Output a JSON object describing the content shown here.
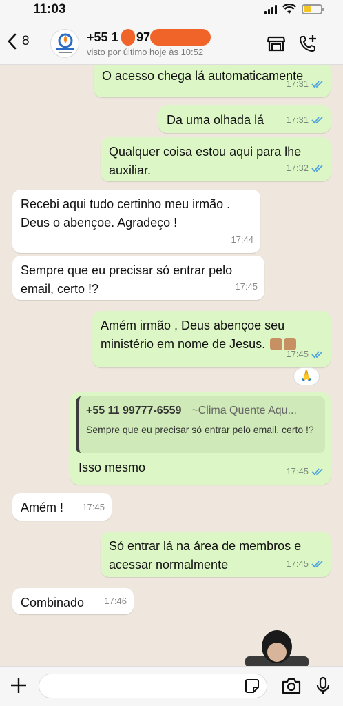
{
  "status_bar": {
    "time": "11:03"
  },
  "header": {
    "back_count": "8",
    "contact_name": "+55 1",
    "contact_name_tail": "97",
    "last_seen": "visto por último hoje às 10:52"
  },
  "messages": [
    {
      "dir": "out",
      "text": "O acesso chega lá automaticamente",
      "time": "17:31"
    },
    {
      "dir": "out",
      "text": "Da uma olhada lá",
      "time": "17:31"
    },
    {
      "dir": "out",
      "text": "Qualquer coisa estou aqui para lhe auxiliar.",
      "time": "17:32"
    },
    {
      "dir": "in",
      "text": "Recebi aqui tudo certinho meu irmão . Deus o abençoe. Agradeço !",
      "time": "17:44"
    },
    {
      "dir": "in",
      "text": "Sempre que eu precisar só entrar pelo email, certo !?",
      "time": "17:45"
    },
    {
      "dir": "out",
      "text": "Amém irmão , Deus abençoe seu ministério em nome de Jesus.",
      "time": "17:45"
    },
    {
      "dir": "out",
      "quote_phone": "+55 11 99777-6559",
      "quote_org": "~Clima Quente Aqu...",
      "quote_text": "Sempre que eu precisar só entrar pelo email, certo !?",
      "text": "Isso mesmo",
      "time": "17:45"
    },
    {
      "dir": "in",
      "text": "Amém !",
      "time": "17:45"
    },
    {
      "dir": "out",
      "text": "Só entrar lá na área de membros e acessar normalmente",
      "time": "17:45"
    },
    {
      "dir": "in",
      "text": "Combinado",
      "time": "17:46"
    }
  ],
  "reaction": {
    "emoji": "🙏"
  },
  "colors": {
    "outgoing_bubble": "#dcf7c5",
    "incoming_bubble": "#ffffff",
    "read_ticks": "#4fa3e0",
    "redaction": "#f0642a"
  },
  "icons": [
    "chevron-left-icon",
    "store-icon",
    "add-call-icon",
    "plus-icon",
    "sticker-icon",
    "camera-icon",
    "microphone-icon"
  ]
}
